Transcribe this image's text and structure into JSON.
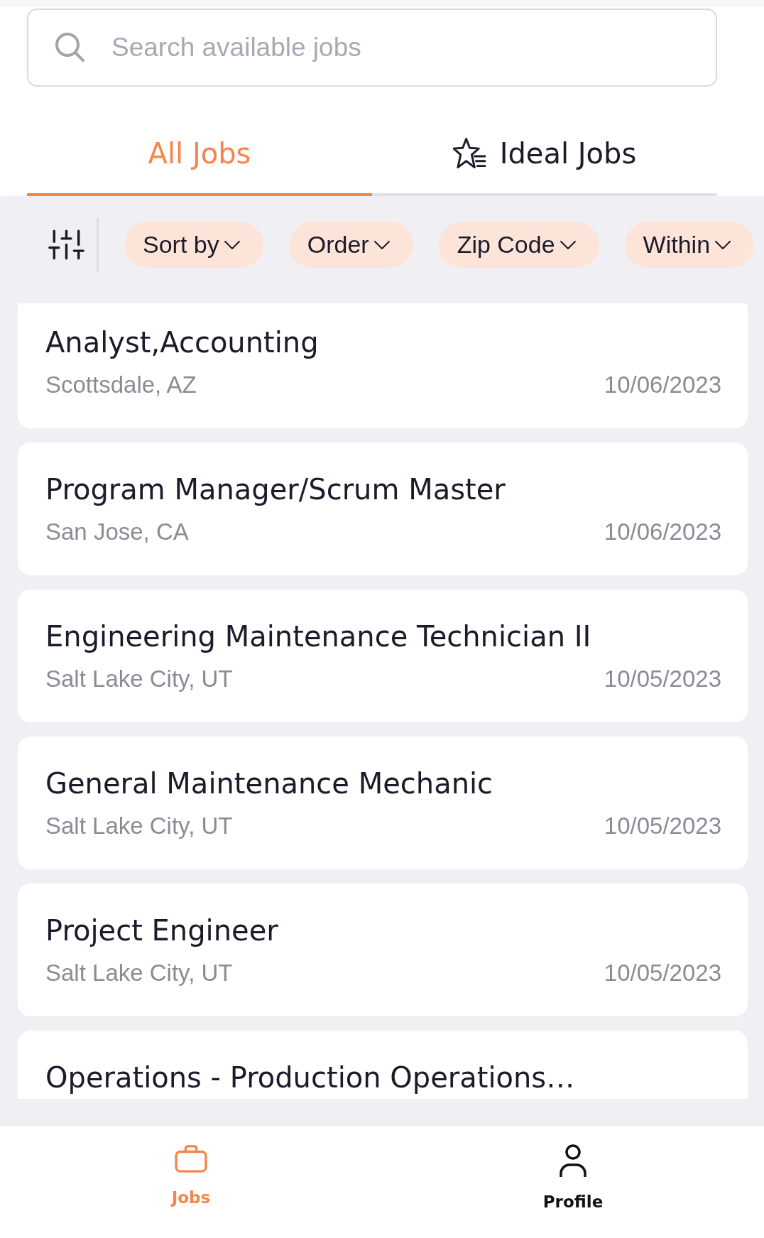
{
  "search": {
    "placeholder": "Search available jobs"
  },
  "tabs": [
    {
      "label": "All Jobs",
      "selected": true,
      "kind": "all"
    },
    {
      "label": "Ideal Jobs",
      "selected": false,
      "kind": "ideal"
    }
  ],
  "filters": [
    {
      "label": "Sort by"
    },
    {
      "label": "Order"
    },
    {
      "label": "Zip Code"
    },
    {
      "label": "Within"
    }
  ],
  "jobs": [
    {
      "title": "Analyst,Accounting",
      "location": "Scottsdale, AZ",
      "date": "10/06/2023"
    },
    {
      "title": "Program Manager/Scrum Master",
      "location": "San Jose, CA",
      "date": "10/06/2023"
    },
    {
      "title": "Engineering Maintenance Technician II",
      "location": "Salt Lake City, UT",
      "date": "10/05/2023"
    },
    {
      "title": "General Maintenance Mechanic",
      "location": "Salt Lake City, UT",
      "date": "10/05/2023"
    },
    {
      "title": "Project Engineer",
      "location": "Salt Lake City, UT",
      "date": "10/05/2023"
    },
    {
      "title": "Operations - Production Operations…"
    }
  ],
  "bottom_nav": [
    {
      "label": "Jobs",
      "selected": true,
      "kind": "jobs"
    },
    {
      "label": "Profile",
      "selected": false,
      "kind": "profile"
    }
  ]
}
